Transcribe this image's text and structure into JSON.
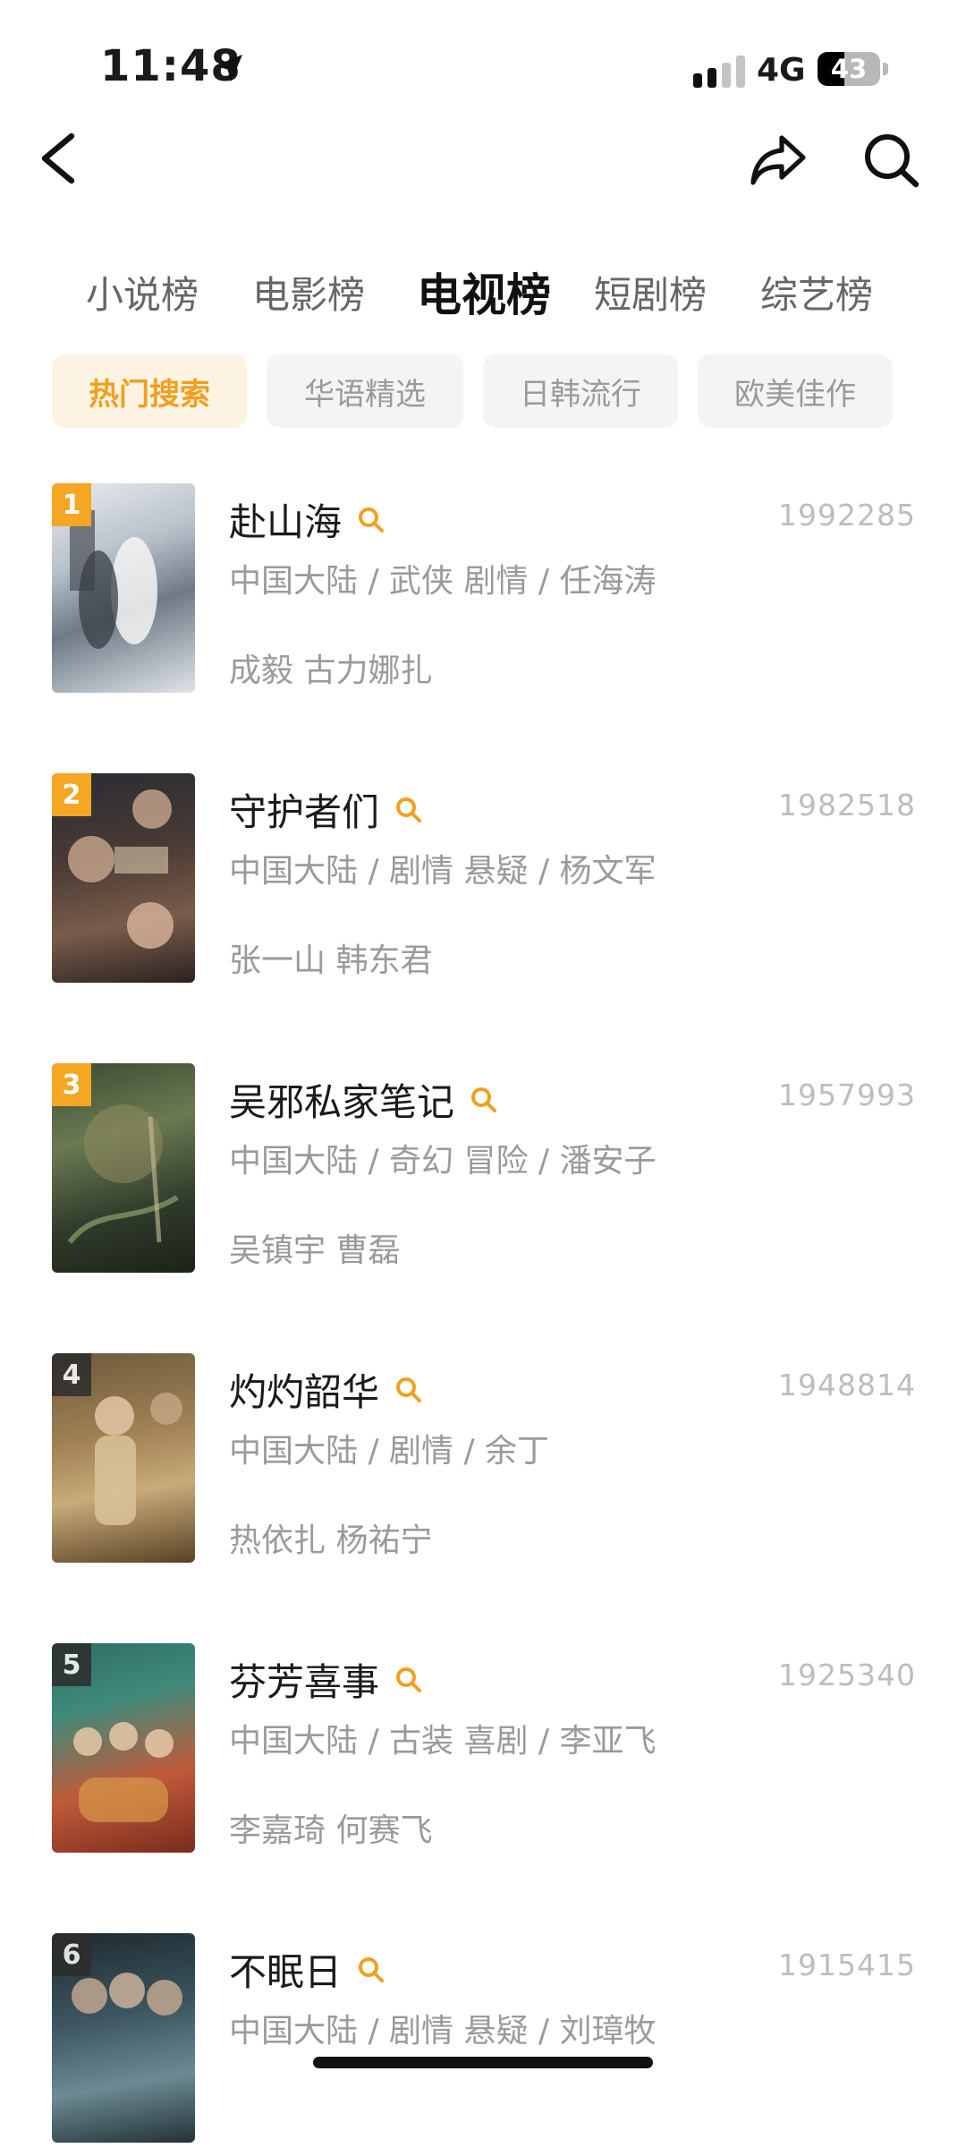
{
  "status_bar": {
    "time": "11:48",
    "network": "4G",
    "battery": "43",
    "battery_level": 0.43
  },
  "nav": {
    "back_icon": "chevron-left-icon",
    "share_icon": "share-icon",
    "search_icon": "search-icon"
  },
  "tabs": [
    "小说榜",
    "电影榜",
    "电视榜",
    "短剧榜",
    "综艺榜"
  ],
  "active_tab": "电视榜",
  "filters": [
    "热门搜索",
    "华语精选",
    "日韩流行",
    "欧美佳作"
  ],
  "active_filter": "热门搜索",
  "colors": {
    "accent": "#f0a020",
    "rank_badge": "#f5a623",
    "rank_badge_other": "#2d2d2d"
  },
  "list": [
    {
      "rank": "1",
      "title": "赴山海",
      "meta": "中国大陆 / 武侠 剧情 / 任海涛",
      "cast": "成毅 古力娜扎",
      "score": "1992285"
    },
    {
      "rank": "2",
      "title": "守护者们",
      "meta": "中国大陆 / 剧情 悬疑 / 杨文军",
      "cast": "张一山 韩东君",
      "score": "1982518"
    },
    {
      "rank": "3",
      "title": "吴邪私家笔记",
      "meta": "中国大陆 / 奇幻 冒险 / 潘安子",
      "cast": "吴镇宇 曹磊",
      "score": "1957993"
    },
    {
      "rank": "4",
      "title": "灼灼韶华",
      "meta": "中国大陆 / 剧情 / 余丁",
      "cast": "热依扎 杨祐宁",
      "score": "1948814"
    },
    {
      "rank": "5",
      "title": "芬芳喜事",
      "meta": "中国大陆 / 古装 喜剧 / 李亚飞",
      "cast": "李嘉琦 何赛飞",
      "score": "1925340"
    },
    {
      "rank": "6",
      "title": "不眠日",
      "meta": "中国大陆 / 剧情 悬疑 / 刘璋牧",
      "cast": "",
      "score": "1915415"
    }
  ]
}
